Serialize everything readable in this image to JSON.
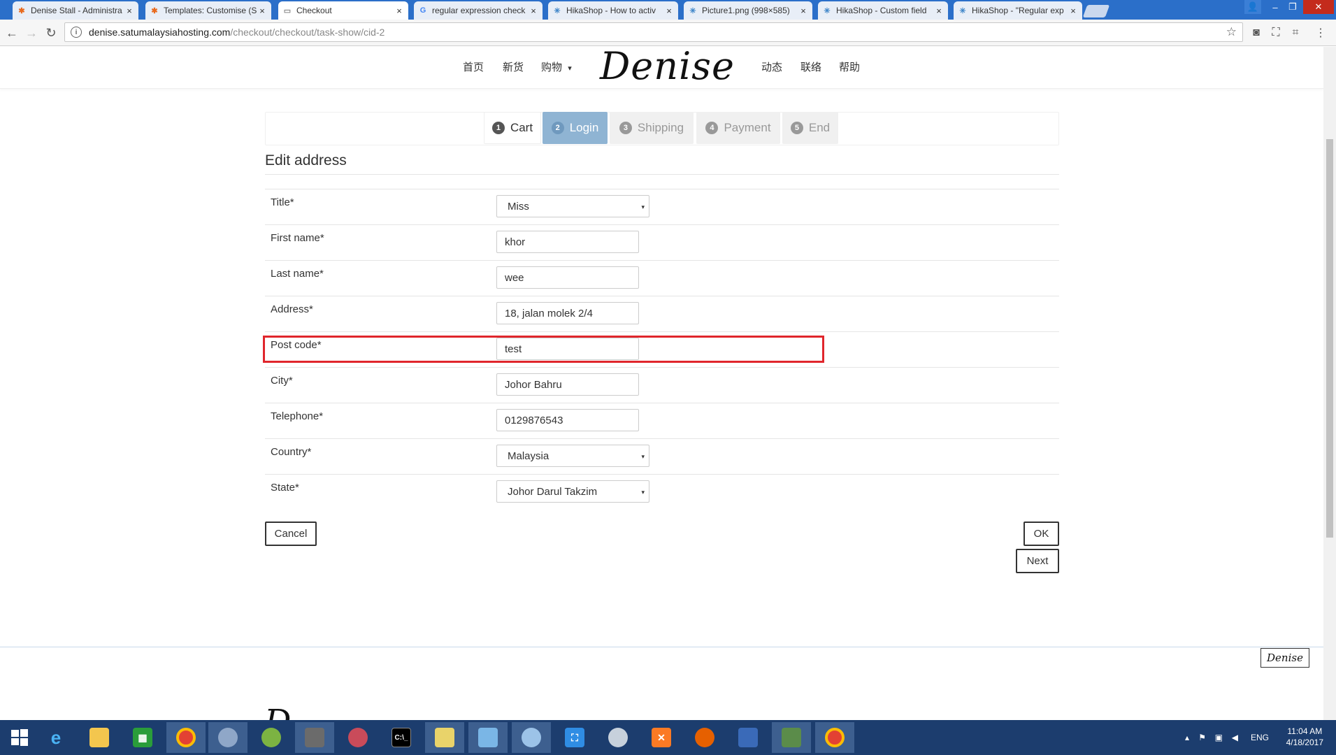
{
  "browser": {
    "tabs": [
      {
        "title": "Denise Stall - Administra",
        "icon": "joomla-icon",
        "active": false
      },
      {
        "title": "Templates: Customise (S",
        "icon": "joomla-icon",
        "active": false
      },
      {
        "title": "Checkout",
        "icon": "page-icon",
        "active": true
      },
      {
        "title": "regular expression check",
        "icon": "google-icon",
        "active": false
      },
      {
        "title": "HikaShop - How to activ",
        "icon": "hikashop-icon",
        "active": false
      },
      {
        "title": "Picture1.png (998×585)",
        "icon": "hikashop-icon",
        "active": false
      },
      {
        "title": "HikaShop - Custom field",
        "icon": "hikashop-icon",
        "active": false
      },
      {
        "title": "HikaShop - \"Regular exp",
        "icon": "hikashop-icon",
        "active": false
      }
    ],
    "url_host": "denise.satumalaysiahosting.com",
    "url_path": "/checkout/checkout/task-show/cid-2",
    "close_glyph": "×"
  },
  "site": {
    "nav_left": [
      "首页",
      "新货",
      "购物"
    ],
    "nav_right": [
      "动态",
      "联络",
      "帮助"
    ],
    "logo_text": "Denise",
    "dropdown_caret": "▾"
  },
  "steps": [
    {
      "num": "1",
      "label": "Cart",
      "state": "done"
    },
    {
      "num": "2",
      "label": "Login",
      "state": "current"
    },
    {
      "num": "3",
      "label": "Shipping",
      "state": "todo"
    },
    {
      "num": "4",
      "label": "Payment",
      "state": "todo"
    },
    {
      "num": "5",
      "label": "End",
      "state": "todo"
    }
  ],
  "form": {
    "title": "Edit address",
    "fields": [
      {
        "label": "Title*",
        "value": "Miss",
        "type": "select"
      },
      {
        "label": "First name*",
        "value": "khor",
        "type": "text"
      },
      {
        "label": "Last name*",
        "value": "wee",
        "type": "text"
      },
      {
        "label": "Address*",
        "value": "18, jalan molek 2/4",
        "type": "text"
      },
      {
        "label": "Post code*",
        "value": "test",
        "type": "text"
      },
      {
        "label": "City*",
        "value": "Johor Bahru",
        "type": "text"
      },
      {
        "label": "Telephone*",
        "value": "0129876543",
        "type": "text"
      },
      {
        "label": "Country*",
        "value": "Malaysia",
        "type": "select"
      },
      {
        "label": "State*",
        "value": "Johor Darul Takzim",
        "type": "select"
      }
    ],
    "cancel_label": "Cancel",
    "ok_label": "OK",
    "next_label": "Next"
  },
  "footer": {
    "logo_small": "Denise",
    "logo_partial": "D"
  },
  "taskbar": {
    "language": "ENG",
    "time": "11:04 AM",
    "date": "4/18/2017"
  },
  "colors": {
    "accent_step": "#8fb4d3",
    "highlight": "#e0262c",
    "taskbar": "#1c3d6e"
  }
}
